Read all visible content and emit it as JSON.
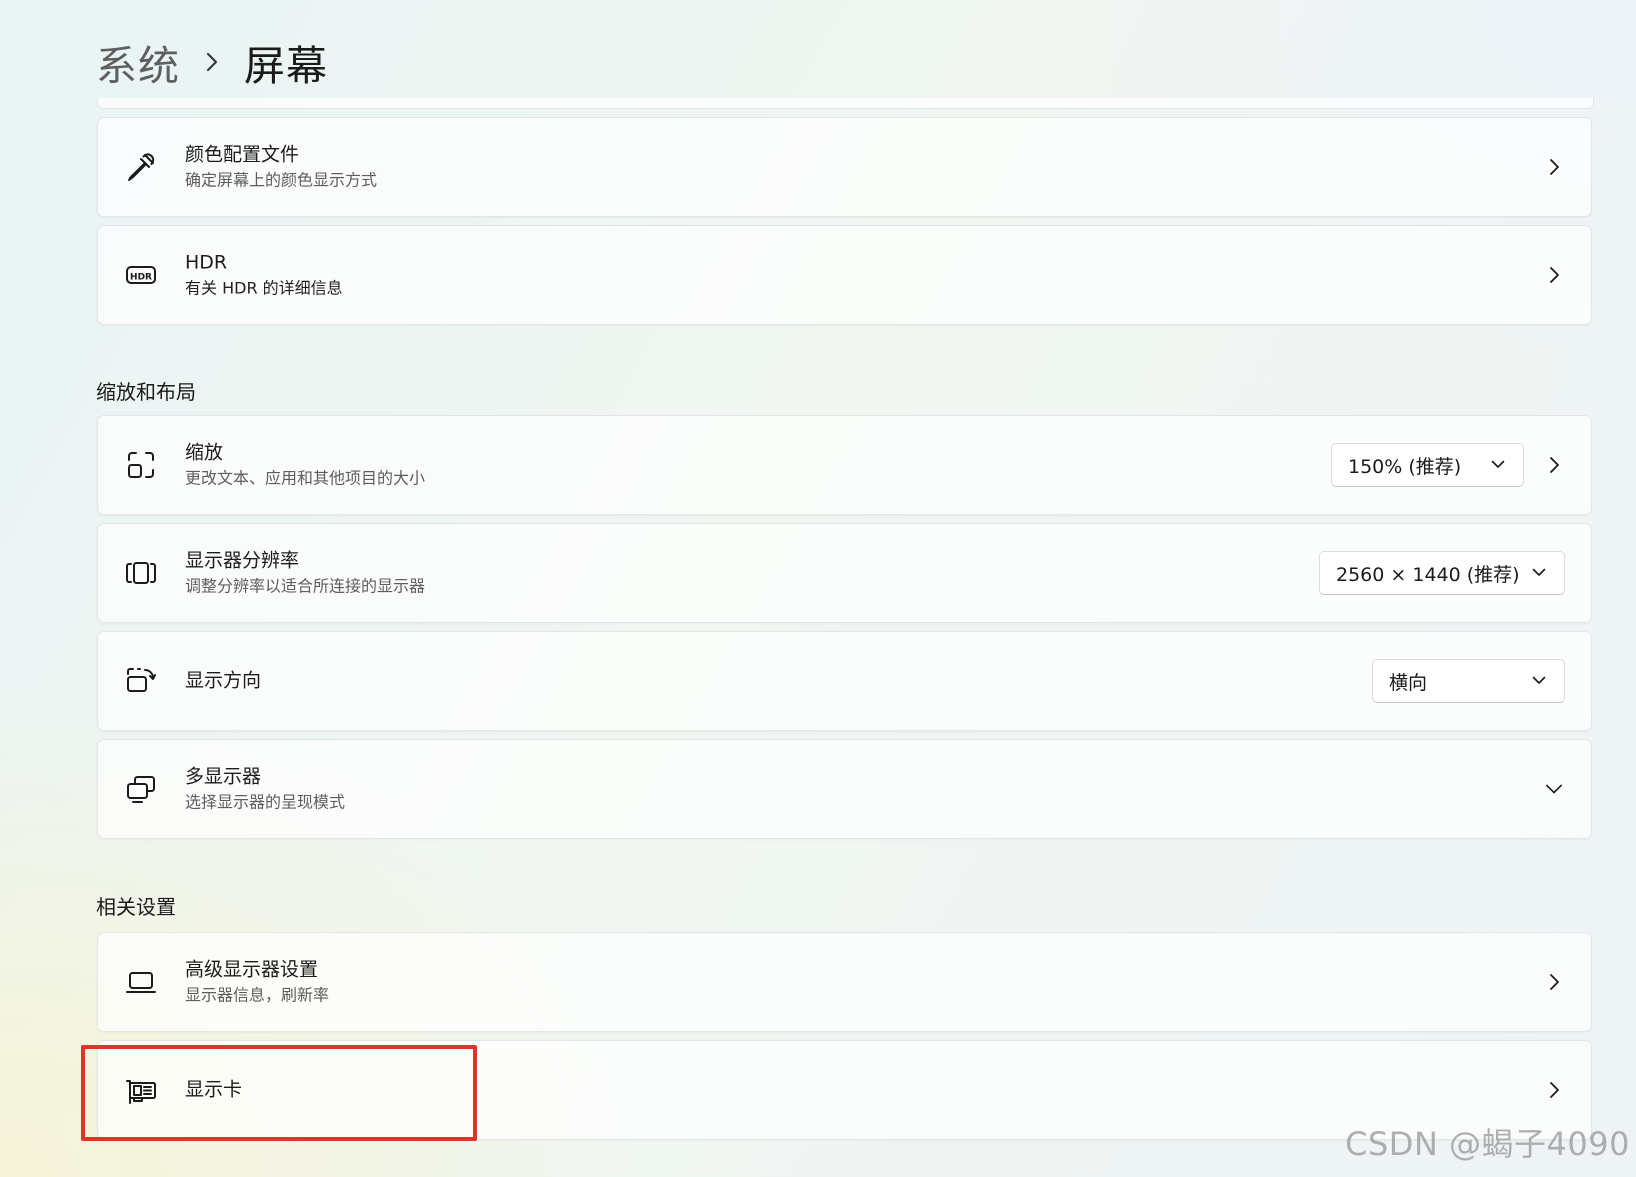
{
  "header": {
    "parent": "系统",
    "current": "屏幕"
  },
  "cards_top": [
    {
      "id": "color-profile",
      "title": "颜色配置文件",
      "subtitle": "确定屏幕上的颜色显示方式",
      "icon": "eyedropper-icon"
    },
    {
      "id": "hdr",
      "title": "HDR",
      "subtitle": "有关 HDR 的详细信息",
      "icon": "hdr-icon"
    }
  ],
  "section_scale": {
    "title": "缩放和布局",
    "items": [
      {
        "id": "scale",
        "title": "缩放",
        "subtitle": "更改文本、应用和其他项目的大小",
        "icon": "resize-icon",
        "dropdown": "150% (推荐)"
      },
      {
        "id": "resolution",
        "title": "显示器分辨率",
        "subtitle": "调整分辨率以适合所连接的显示器",
        "icon": "resolution-icon",
        "dropdown": "2560 × 1440 (推荐)"
      },
      {
        "id": "orientation",
        "title": "显示方向",
        "subtitle": "",
        "icon": "rotate-screen-icon",
        "dropdown": "横向"
      },
      {
        "id": "multi-display",
        "title": "多显示器",
        "subtitle": "选择显示器的呈现模式",
        "icon": "multi-monitor-icon"
      }
    ]
  },
  "section_related": {
    "title": "相关设置",
    "items": [
      {
        "id": "advanced-display",
        "title": "高级显示器设置",
        "subtitle": "显示器信息，刷新率",
        "icon": "laptop-icon"
      },
      {
        "id": "graphics",
        "title": "显示卡",
        "subtitle": "",
        "icon": "graphics-card-icon"
      }
    ]
  },
  "watermark": "CSDN @蝎子4090",
  "colors": {
    "highlight": "#e8302a",
    "text": "#1b1b1b",
    "subtext": "#5d5d5d"
  }
}
